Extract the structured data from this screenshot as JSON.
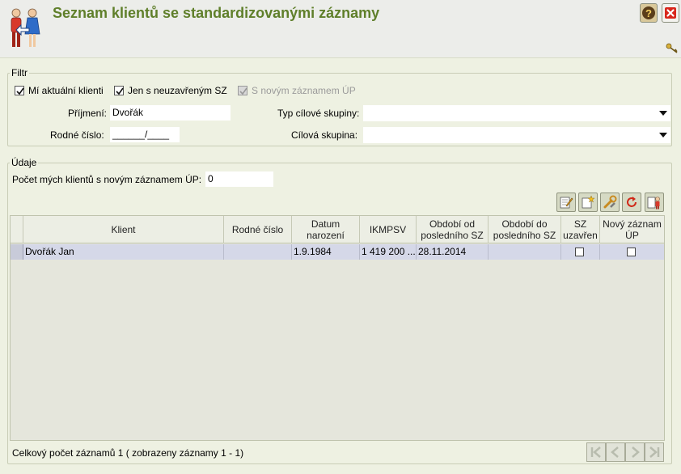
{
  "header": {
    "title": "Seznam klientů se standardizovanými záznamy"
  },
  "filter": {
    "legend": "Filtr",
    "checkboxes": [
      {
        "label": "Mí aktuální klienti",
        "checked": true,
        "disabled": false
      },
      {
        "label": "Jen s neuzavřeným SZ",
        "checked": true,
        "disabled": false
      },
      {
        "label": "S novým záznamem ÚP",
        "checked": true,
        "disabled": true
      }
    ],
    "prijmeni_label": "Příjmení:",
    "prijmeni_value": "Dvořák",
    "rodne_cislo_label": "Rodné číslo:",
    "rodne_cislo_value": "______/____",
    "typ_cilove_skupiny_label": "Typ cílové skupiny:",
    "typ_cilove_skupiny_value": "",
    "cilova_skupina_label": "Cílová skupina:",
    "cilova_skupina_value": ""
  },
  "udaje": {
    "legend": "Údaje",
    "count_label": "Počet mých klientů s novým záznamem ÚP:",
    "count_value": "0"
  },
  "toolbar": {
    "icons": [
      "edit-icon",
      "new-record-icon",
      "tools-icon",
      "refresh-icon",
      "client-detail-icon"
    ]
  },
  "table": {
    "columns": [
      "Klient",
      "Rodné číslo",
      "Datum narození",
      "IKMPSV",
      "Období od posledního SZ",
      "Období do posledního SZ",
      "SZ uzavřen",
      "Nový záznam ÚP"
    ],
    "rows": [
      {
        "klient": "Dvořák Jan",
        "rodne_cislo": "",
        "datum_narozeni": "1.9.1984",
        "ikmpsv": "1 419 200 ...",
        "obdobi_od": "28.11.2014",
        "obdobi_do": "",
        "sz_uzavren": false,
        "novy_zaznam_up": false
      }
    ]
  },
  "footer": {
    "summary": "Celkový počet záznamů 1 ( zobrazeny záznamy 1 - 1)"
  },
  "colors": {
    "title": "#5f7f2a",
    "background": "#eef1e2",
    "selected_row": "#d5d8e8"
  }
}
